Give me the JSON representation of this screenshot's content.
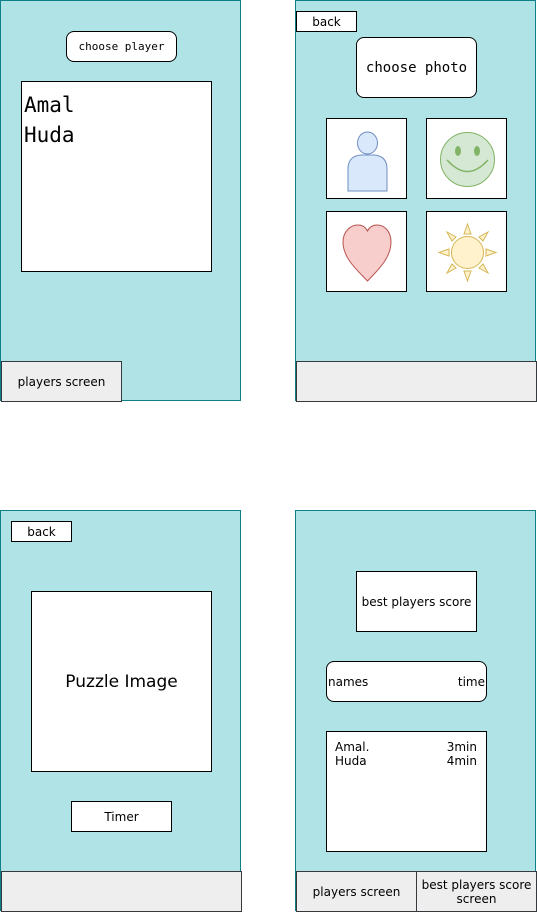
{
  "screen1": {
    "choose_player_button": "choose player",
    "players": [
      "Amal",
      "Huda"
    ],
    "tab_players_screen": "players screen"
  },
  "screen2": {
    "back_button": "back",
    "choose_photo_button": "choose photo",
    "photo_options": [
      "person-icon",
      "smiley-icon",
      "heart-icon",
      "sun-icon"
    ]
  },
  "screen3": {
    "back_button": "back",
    "puzzle_image_label": "Puzzle Image",
    "timer_label": "Timer"
  },
  "screen4": {
    "title_box": "best players score",
    "header_names": "names",
    "header_time": "time",
    "rows": [
      {
        "name": "Amal.",
        "time": "3min"
      },
      {
        "name": "Huda",
        "time": "4min"
      }
    ],
    "tab_players_screen": "players screen",
    "tab_best_scores": "best players score screen"
  },
  "colors": {
    "screen_fill": "#b0e3e6",
    "screen_border": "#0e8088",
    "tabbar_fill": "#eeeeee"
  }
}
